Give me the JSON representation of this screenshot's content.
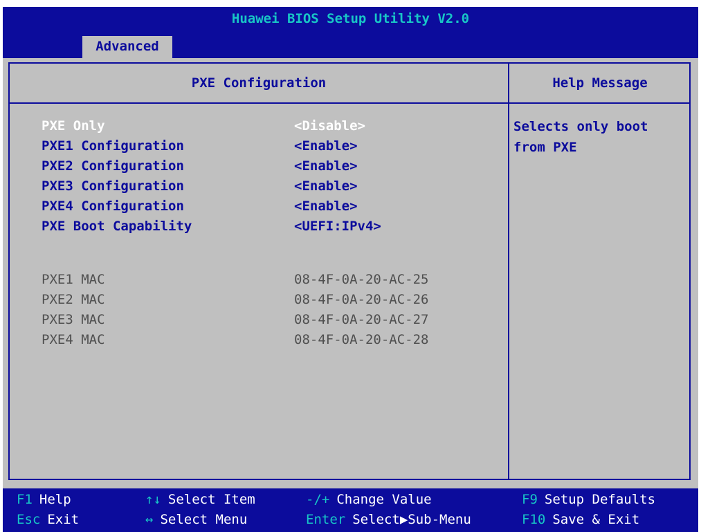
{
  "title": "Huawei BIOS Setup Utility V2.0",
  "tab": "Advanced",
  "panel_title": "PXE Configuration",
  "help_title": "Help Message",
  "help_text": "Selects only boot from PXE",
  "items": [
    {
      "label": "PXE Only",
      "value": "<Disable>"
    },
    {
      "label": "PXE1 Configuration",
      "value": "<Enable>"
    },
    {
      "label": "PXE2 Configuration",
      "value": "<Enable>"
    },
    {
      "label": "PXE3 Configuration",
      "value": "<Enable>"
    },
    {
      "label": "PXE4 Configuration",
      "value": "<Enable>"
    },
    {
      "label": "PXE Boot Capability",
      "value": "<UEFI:IPv4>"
    }
  ],
  "macs": [
    {
      "label": "PXE1 MAC",
      "value": "08-4F-0A-20-AC-25"
    },
    {
      "label": "PXE2 MAC",
      "value": "08-4F-0A-20-AC-26"
    },
    {
      "label": "PXE3 MAC",
      "value": "08-4F-0A-20-AC-27"
    },
    {
      "label": "PXE4 MAC",
      "value": "08-4F-0A-20-AC-28"
    }
  ],
  "footer": {
    "help": {
      "key": "F1",
      "desc": "Help"
    },
    "exit": {
      "key": "Esc",
      "desc": "Exit"
    },
    "sel_item": {
      "key": "↑↓",
      "desc": "Select Item"
    },
    "sel_menu": {
      "key": "↔",
      "desc": "Select Menu"
    },
    "change": {
      "key": "-/+",
      "desc": "Change Value"
    },
    "submenu": {
      "key": "Enter",
      "desc": "Select▶Sub-Menu"
    },
    "defaults": {
      "key": "F9",
      "desc": "Setup Defaults"
    },
    "save": {
      "key": "F10",
      "desc": "Save & Exit"
    }
  },
  "colors": {
    "background": "#0c0c9c",
    "panel": "#c0c0c0",
    "accent": "#18c6c6",
    "selected": "#ffffff"
  }
}
